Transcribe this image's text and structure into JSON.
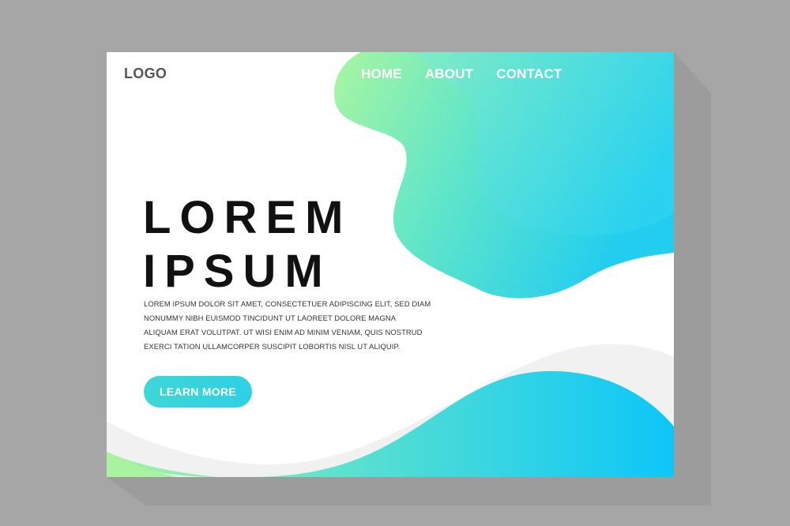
{
  "header": {
    "logo": "LOGO",
    "nav": [
      {
        "label": "HOME"
      },
      {
        "label": "ABOUT"
      },
      {
        "label": "CONTACT"
      }
    ]
  },
  "hero": {
    "title_line1": "LOREM",
    "title_line2": "IPSUM",
    "body_lines": [
      "LOREM IPSUM DOLOR SIT AMET, CONSECTETUER ADIPISCING ELIT, SED DIAM",
      "NONUMMY NIBH EUISMOD TINCIDUNT UT LAOREET DOLORE MAGNA",
      "ALIQUAM ERAT VOLUTPAT. UT WISI ENIM AD MINIM VENIAM, QUIS NOSTRUD",
      "EXERCI TATION ULLAMCORPER SUSCIPIT LOBORTIS NISL UT ALIQUIP."
    ],
    "cta_label": "LEARN MORE"
  },
  "colors": {
    "backdrop": "#a6a6a6",
    "gradient_start": "#a7f59a",
    "gradient_mid": "#4fe0d4",
    "gradient_end": "#15c7f6",
    "title": "#111111",
    "logo": "#555555"
  }
}
